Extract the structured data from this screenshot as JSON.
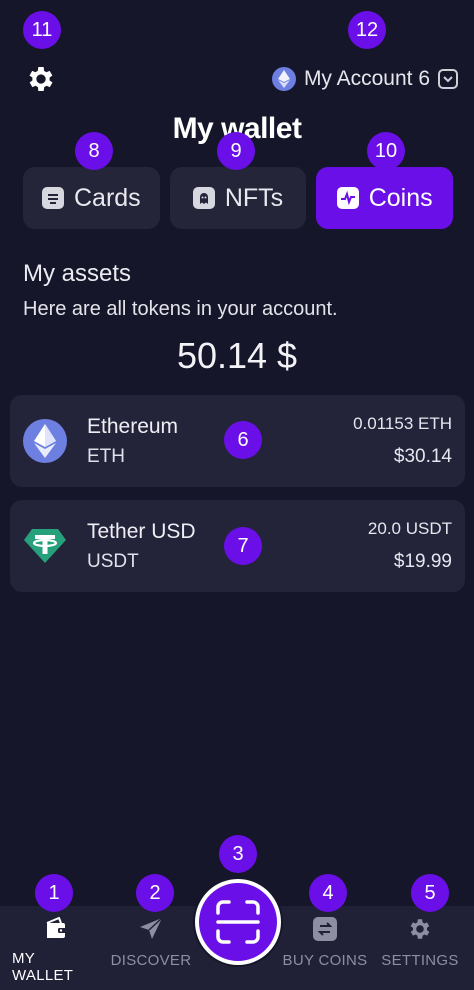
{
  "header": {
    "account_label": "My Account 6",
    "title": "My wallet"
  },
  "tabs": [
    {
      "label": "Cards",
      "active": false
    },
    {
      "label": "NFTs",
      "active": false
    },
    {
      "label": "Coins",
      "active": true
    }
  ],
  "assets": {
    "heading": "My assets",
    "subtitle": "Here are all tokens in your account.",
    "total": "50.14 $"
  },
  "coins": [
    {
      "name": "Ethereum",
      "symbol": "ETH",
      "amount": "0.01153 ETH",
      "usd": "$30.14",
      "icon": "ethereum-icon"
    },
    {
      "name": "Tether USD",
      "symbol": "USDT",
      "amount": "20.0 USDT",
      "usd": "$19.99",
      "icon": "tether-icon"
    }
  ],
  "nav": [
    {
      "label": "MY WALLET",
      "icon": "wallet-icon",
      "active": true
    },
    {
      "label": "DISCOVER",
      "icon": "navigation-arrow-icon",
      "active": false
    },
    {
      "label": "BUY COINS",
      "icon": "exchange-icon",
      "active": false
    },
    {
      "label": "SETTINGS",
      "icon": "gear-icon",
      "active": false
    }
  ],
  "markers": [
    "1",
    "2",
    "3",
    "4",
    "5",
    "6",
    "7",
    "8",
    "9",
    "10",
    "11",
    "12"
  ],
  "colors": {
    "background": "#16162a",
    "surface": "#23233a",
    "accent": "#6b0fe8",
    "muted_text": "#8e8ea3"
  }
}
